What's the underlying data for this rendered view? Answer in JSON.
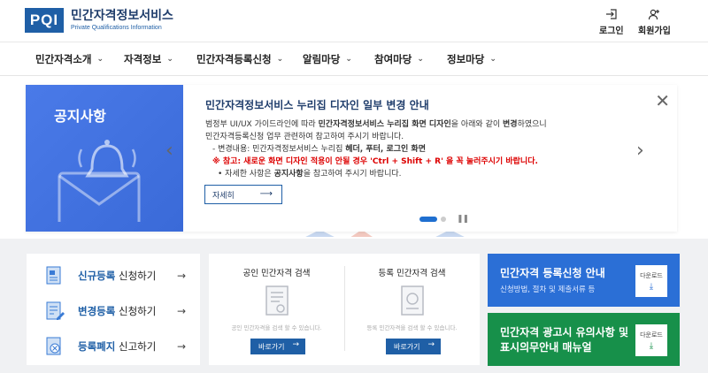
{
  "header": {
    "logo_mark": "PQI",
    "logo_kr": "민간자격정보서비스",
    "logo_en": "Private Qualifications Information",
    "login": "로그인",
    "signup": "회원가입"
  },
  "gnb": [
    {
      "label": "민간자격소개"
    },
    {
      "label": "자격정보"
    },
    {
      "label": "민간자격등록신청"
    },
    {
      "label": "알림마당"
    },
    {
      "label": "참여마당"
    },
    {
      "label": "정보마당"
    }
  ],
  "chevron": "⌄",
  "banner": {
    "tag": "공지사항",
    "title": "민간자격정보서비스 누리집 디자인 일부 변경 안내",
    "line1_a": "범정부 UI/UX 가이드라인에 따라 ",
    "line1_b": "민간자격정보서비스 누리집 화면 디자인",
    "line1_c": "을 아래와 같이 ",
    "line1_d": "변경",
    "line1_e": "하였으니",
    "line2": "민간자격등록신청 업무 관련하여 참고하여 주시기 바랍니다.",
    "line3_a": "- 변경내용: 민간자격정보서비스 누리집 ",
    "line3_b": "헤더, 푸터, 로그인 화면",
    "line4": "※ 참고: 새로운 화면 디자인 적용이 안될 경우 'Ctrl + Shift + R' 을 꼭 눌러주시기 바랍니다.",
    "line5_a": "• 자세한 사항은 ",
    "line5_b": "공지사항",
    "line5_c": "을 참고하여 주시기 바랍니다.",
    "more": "자세히",
    "prev": "‹",
    "next": "›",
    "close": "✕",
    "pause": "❚❚",
    "arrow": "⟶"
  },
  "registration": [
    {
      "em": "신규등록",
      "rest": " 신청하기"
    },
    {
      "em": "변경등록",
      "rest": " 신청하기"
    },
    {
      "em": "등록폐지",
      "rest": " 신고하기"
    }
  ],
  "go_arrow": "→",
  "search": {
    "public": {
      "title": "공인 민간자격 검색",
      "placeholder": "공인 민간자격을 검색 할 수 있습니다.",
      "button": "바로가기"
    },
    "registered": {
      "title": "등록 민간자격 검색",
      "placeholder": "등록 민간자격을 검색 할 수 있습니다.",
      "button": "바로가기"
    }
  },
  "guide": {
    "title": "민간자격 등록신청 안내",
    "subtitle": "신청방법, 절차 및 제출서류 등",
    "download": "다운로드"
  },
  "manual": {
    "title_1": "민간자격 광고시 유의사항 및",
    "title_2": "표시의무안내 매뉴얼",
    "download": "다운로드"
  },
  "download_arrow": "⤓",
  "colors": {
    "primary": "#1f5fa6",
    "blue_card": "#2b6fd6",
    "green_card": "#17904a",
    "banner_left": "#4a7ae8"
  }
}
